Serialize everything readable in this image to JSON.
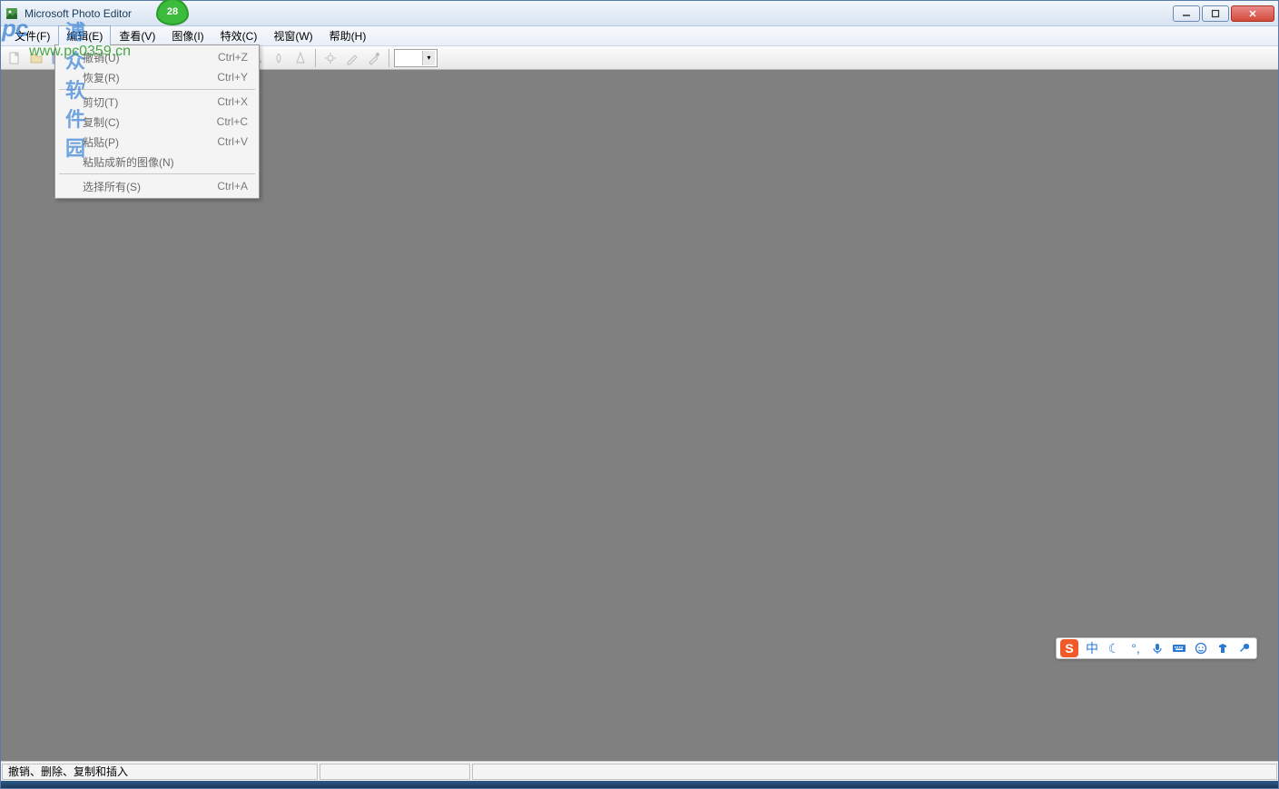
{
  "titlebar": {
    "title": "Microsoft Photo Editor"
  },
  "menubar": {
    "items": [
      {
        "label": "文件(F)"
      },
      {
        "label": "编辑(E)"
      },
      {
        "label": "查看(V)"
      },
      {
        "label": "图像(I)"
      },
      {
        "label": "特效(C)"
      },
      {
        "label": "视窗(W)"
      },
      {
        "label": "帮助(H)"
      }
    ]
  },
  "dropdown": {
    "items": [
      {
        "label": "撤销(U)",
        "shortcut": "Ctrl+Z"
      },
      {
        "label": "恢复(R)",
        "shortcut": "Ctrl+Y"
      },
      {
        "sep": true
      },
      {
        "label": "剪切(T)",
        "shortcut": "Ctrl+X"
      },
      {
        "label": "复制(C)",
        "shortcut": "Ctrl+C"
      },
      {
        "label": "粘贴(P)",
        "shortcut": "Ctrl+V"
      },
      {
        "label": "粘贴成新的图像(N)",
        "shortcut": ""
      },
      {
        "sep": true
      },
      {
        "label": "选择所有(S)",
        "shortcut": "Ctrl+A"
      }
    ]
  },
  "statusbar": {
    "text": "撤销、删除、复制和插入"
  },
  "watermark": {
    "bubble": "28",
    "logo": "pc",
    "cn": "溥众软件园",
    "url": "www.pc0359.cn"
  },
  "ime": {
    "lang": "中"
  }
}
